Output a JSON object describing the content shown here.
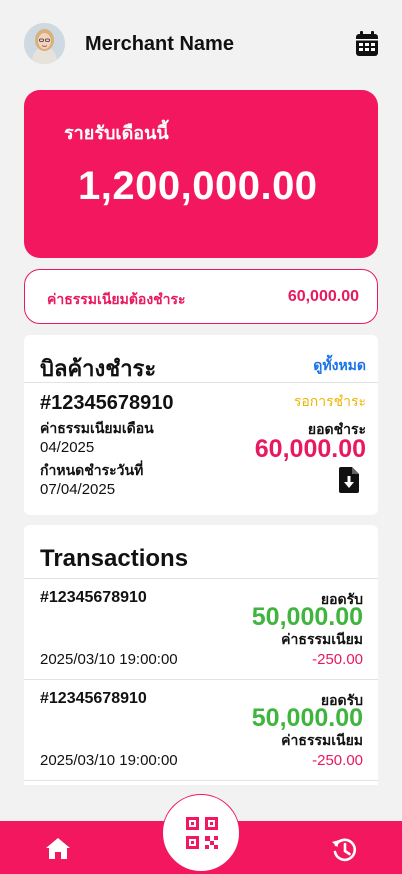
{
  "header": {
    "merchant_name": "Merchant Name"
  },
  "income": {
    "label": "รายรับเดือนนี้",
    "value": "1,200,000.00"
  },
  "fee_due": {
    "label": "ค่าธรรมเนียมต้องชำระ",
    "value": "60,000.00"
  },
  "bill": {
    "title": "บิลค้างชำระ",
    "view_all": "ดูทั้งหมด",
    "number": "#12345678910",
    "status": "รอการชำระ",
    "fee_month_label": "ค่าธรรมเนียมเดือน",
    "fee_month": "04/2025",
    "due_date_label": "กำหนดชำระวันที่",
    "due_date": "07/04/2025",
    "amount_label": "ยอดชำระ",
    "amount": "60,000.00"
  },
  "transactions": {
    "title": "Transactions",
    "items": [
      {
        "number": "#12345678910",
        "received_label": "ยอดรับ",
        "received": "50,000.00",
        "fee_label": "ค่าธรรมเนียม",
        "datetime": "2025/03/10 19:00:00",
        "fee": "-250.00"
      },
      {
        "number": "#12345678910",
        "received_label": "ยอดรับ",
        "received": "50,000.00",
        "fee_label": "ค่าธรรมเนียม",
        "datetime": "2025/03/10 19:00:00",
        "fee": "-250.00"
      }
    ]
  },
  "nav": {
    "icons": [
      "home-icon",
      "qr-code-icon",
      "history-icon"
    ],
    "accent": "#f2175f"
  }
}
